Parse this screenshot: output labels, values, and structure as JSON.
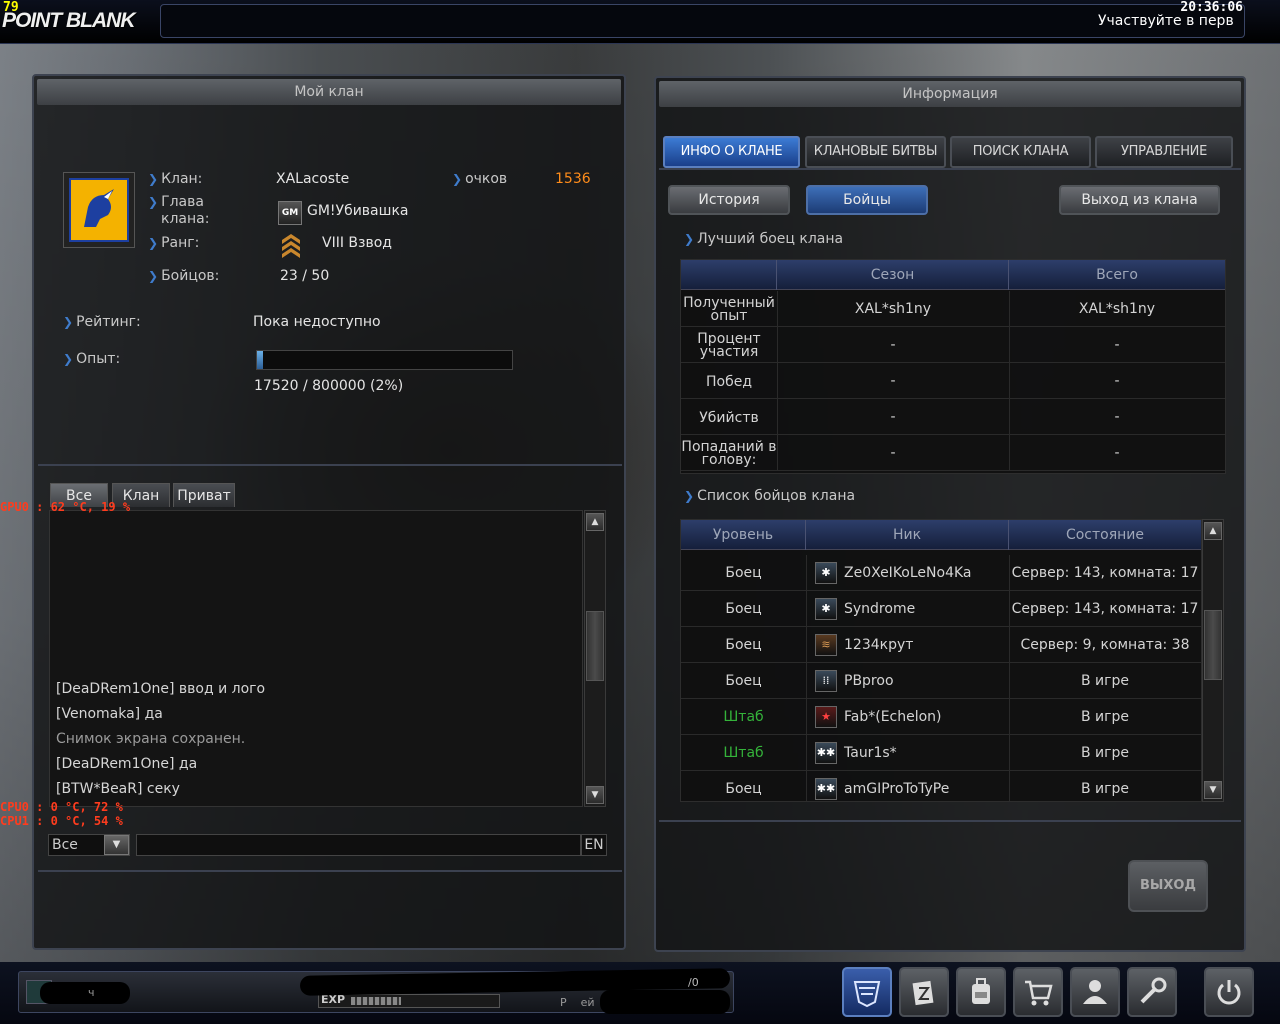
{
  "hud": {
    "fps": "79",
    "logo": "POINT BLANK",
    "clock": "20:36:06",
    "ticker": "Участвуйте в перв"
  },
  "my_clan": {
    "title": "Мой клан",
    "clan_label": "Клан:",
    "clan_value": "XALacoste",
    "points_label": "очков",
    "points_value": "1536",
    "leader_label_1": "Глава",
    "leader_label_2": "клана:",
    "leader_badge": "GM",
    "leader_value": "GM!Убивашка",
    "rank_label": "Ранг:",
    "rank_value": "VIII Взвод",
    "members_label": "Бойцов:",
    "members_value": "23 / 50",
    "rating_label": "Рейтинг:",
    "rating_value": "Пока недоступно",
    "exp_label": "Опыт:",
    "exp_value": "17520 / 800000 (2%)",
    "exp_fraction": 0.022
  },
  "chat": {
    "tabs": [
      "Все",
      "Клан",
      "Приват"
    ],
    "lines": [
      {
        "text": "[DeaDRem1One] ввод и лого",
        "system": false
      },
      {
        "text": "[Venomaka] да",
        "system": false
      },
      {
        "text": "Снимок экрана сохранен.",
        "system": true
      },
      {
        "text": "[DeaDRem1One] да",
        "system": false
      },
      {
        "text": "[BTW*BeaR] секу",
        "system": false
      }
    ],
    "channel": "Все",
    "lang": "EN"
  },
  "info": {
    "title": "Информация",
    "tabs": [
      "ИНФО О КЛАНЕ",
      "КЛАНОВЫЕ БИТВЫ",
      "ПОИСК КЛАНА",
      "УПРАВЛЕНИЕ"
    ],
    "history_button": "История",
    "fighters_button": "Бойцы",
    "leave_button": "Выход из клана",
    "best_title": "Лучший боец клана",
    "best_headers": [
      "",
      "Сезон",
      "Всего"
    ],
    "best_rows": [
      {
        "label": "Полученный опыт",
        "l1": "Полученный",
        "l2": "опыт",
        "season": "XAL*sh1ny",
        "total": "XAL*sh1ny"
      },
      {
        "label": "Процент участия",
        "l1": "Процент",
        "l2": "участия",
        "season": "-",
        "total": "-"
      },
      {
        "label": "Побед",
        "l1": "Побед",
        "l2": "",
        "season": "-",
        "total": "-"
      },
      {
        "label": "Убийств",
        "l1": "Убийств",
        "l2": "",
        "season": "-",
        "total": "-"
      },
      {
        "label": "Попаданий в голову",
        "l1": "Попаданий в",
        "l2": "голову:",
        "season": "-",
        "total": "-"
      }
    ],
    "list_title": "Список бойцов клана",
    "list_headers": [
      "Уровень",
      "Ник",
      "Состояние"
    ],
    "members": [
      {
        "level": "Боец",
        "officer": false,
        "nick": "Ze0XeIKoLeNo4Ka",
        "status": "Сервер: 143, комната: 17",
        "icon": "rank-star-icon"
      },
      {
        "level": "Боец",
        "officer": false,
        "nick": "Syndrome",
        "status": "Сервер: 143, комната: 17",
        "icon": "rank-star-icon"
      },
      {
        "level": "Боец",
        "officer": false,
        "nick": "1234крут",
        "status": "Сервер: 9, комната: 38",
        "icon": "rank-chevron-icon"
      },
      {
        "level": "Боец",
        "officer": false,
        "nick": "PBproo",
        "status": "В игре",
        "icon": "rank-wings-icon"
      },
      {
        "level": "Штаб",
        "officer": true,
        "nick": "Fab*(Echelon)",
        "status": "В игре",
        "icon": "rank-red-star-icon"
      },
      {
        "level": "Штаб",
        "officer": true,
        "nick": "Taur1s*",
        "status": "В игре",
        "icon": "rank-double-star-icon"
      },
      {
        "level": "Боец",
        "officer": false,
        "nick": "amGIProToTyPe",
        "status": "В игре",
        "icon": "rank-double-star-icon"
      }
    ],
    "exit_button": "ВЫХОД"
  },
  "overlay": {
    "gpu": "GPU0 : 62 °C, 19 %",
    "cpu0": "CPU0 :  0 °C, 72 %",
    "cpu1": "CPU1 :  0 °C, 54 %"
  },
  "bottom": {
    "exp_tag": "EXP",
    "fragment_1": "ч",
    "fragment_2": "/0",
    "fragment_3": "Р    ей",
    "dock_icons": [
      "clan-icon",
      "inventory-icon",
      "backpack-icon",
      "shop-icon",
      "community-icon",
      "settings-wrench-icon",
      "power-icon"
    ]
  },
  "colors": {
    "accent_blue": "#3f7ccc",
    "points_orange": "#ff8c1a",
    "officer_green": "#34b33a",
    "overlay_red": "#ff3c1e"
  }
}
